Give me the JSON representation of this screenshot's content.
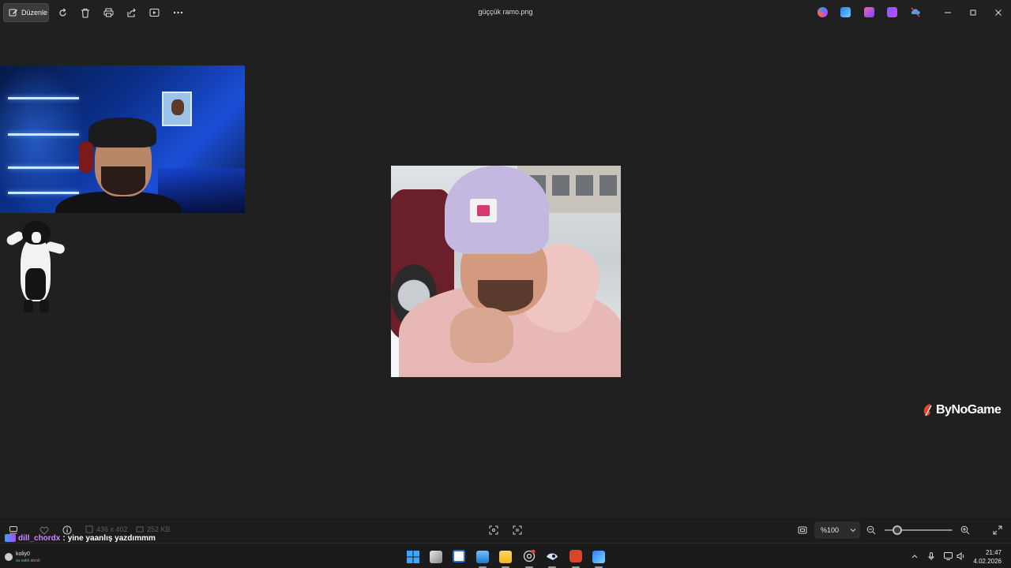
{
  "toolbar": {
    "edit_label": "Düzenle",
    "file_title": "güççük ramo.png"
  },
  "chat": {
    "username": "dill_chordx",
    "separator": ":",
    "message": "yine yaanlış yazdımmm"
  },
  "watermark": {
    "brand": "ByNoGame"
  },
  "statusbar": {
    "dimensions": "436 x 402",
    "file_size": "252 KB",
    "zoom": "%100"
  },
  "taskbar": {
    "weather_title": "koliy0",
    "weather_line_green": "su vakti",
    "weather_line_grey": "abndi",
    "time": "21:47",
    "date": "4.02.2026"
  },
  "colors": {
    "background": "#202020",
    "chat_username": "#c98aff",
    "accent_red": "#e8452f"
  },
  "icons": [
    "edit-icon",
    "rotate-icon",
    "delete-icon",
    "print-icon",
    "share-icon",
    "slideshow-icon",
    "more-icon",
    "favorite-icon",
    "info-icon",
    "fit-icon",
    "zoom-out-icon",
    "zoom-in-icon",
    "fullscreen-icon"
  ]
}
